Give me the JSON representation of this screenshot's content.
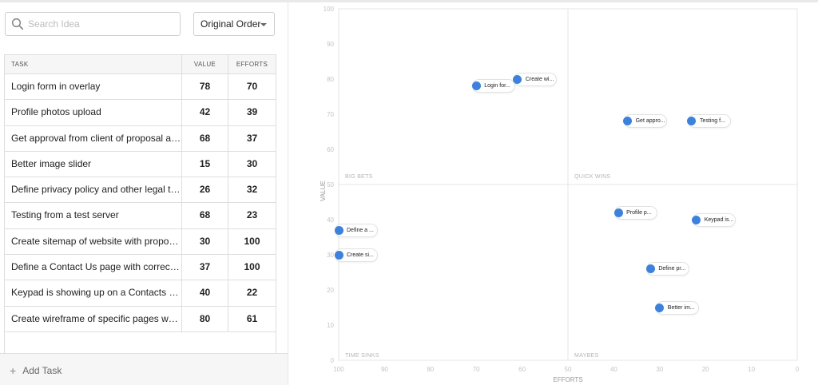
{
  "search": {
    "placeholder": "Search Idea"
  },
  "order": {
    "label": "Original Order"
  },
  "table": {
    "headers": [
      "TASK",
      "VALUE",
      "EFFORTS"
    ],
    "rows": [
      {
        "task": "Login form in overlay",
        "value": 78,
        "efforts": 70
      },
      {
        "task": "Profile photos upload",
        "value": 42,
        "efforts": 39
      },
      {
        "task": "Get approval from client of proposal and f...",
        "value": 68,
        "efforts": 37
      },
      {
        "task": "Better image slider",
        "value": 15,
        "efforts": 30
      },
      {
        "task": "Define privacy policy and other legal text r...",
        "value": 26,
        "efforts": 32
      },
      {
        "task": "Testing from a test server",
        "value": 68,
        "efforts": 23
      },
      {
        "task": "Create sitemap of website with proposed ...",
        "value": 30,
        "efforts": 100
      },
      {
        "task": "Define a Contact Us page with correct clie...",
        "value": 37,
        "efforts": 100
      },
      {
        "task": "Keypad is showing up on a Contacts screen",
        "value": 40,
        "efforts": 22
      },
      {
        "task": "Create wireframe of specific pages which ...",
        "value": 80,
        "efforts": 61
      }
    ]
  },
  "footer": {
    "add_label": "Add Task"
  },
  "chart_data": {
    "type": "scatter",
    "xlabel": "EFFORTS",
    "ylabel": "VALUE",
    "xlim": [
      100,
      0
    ],
    "ylim": [
      0,
      100
    ],
    "x_ticks": [
      100,
      90,
      80,
      70,
      60,
      50,
      40,
      30,
      20,
      10,
      0
    ],
    "y_ticks": [
      0,
      10,
      20,
      30,
      40,
      50,
      60,
      70,
      80,
      90,
      100
    ],
    "quadrants": [
      "BIG BETS",
      "QUICK WINS",
      "TIME SINKS",
      "MAYBES"
    ],
    "points": [
      {
        "label": "Login for...",
        "x": 70,
        "y": 78
      },
      {
        "label": "Create wi...",
        "x": 61,
        "y": 80
      },
      {
        "label": "Get appro...",
        "x": 37,
        "y": 68
      },
      {
        "label": "Testing f...",
        "x": 23,
        "y": 68
      },
      {
        "label": "Profile p...",
        "x": 39,
        "y": 42
      },
      {
        "label": "Keypad is...",
        "x": 22,
        "y": 40
      },
      {
        "label": "Define a ...",
        "x": 100,
        "y": 37
      },
      {
        "label": "Create si...",
        "x": 100,
        "y": 30
      },
      {
        "label": "Define pr...",
        "x": 32,
        "y": 26
      },
      {
        "label": "Better im...",
        "x": 30,
        "y": 15
      }
    ],
    "point_color": "#3c82dc",
    "grid_color": "#e4e4e4"
  }
}
